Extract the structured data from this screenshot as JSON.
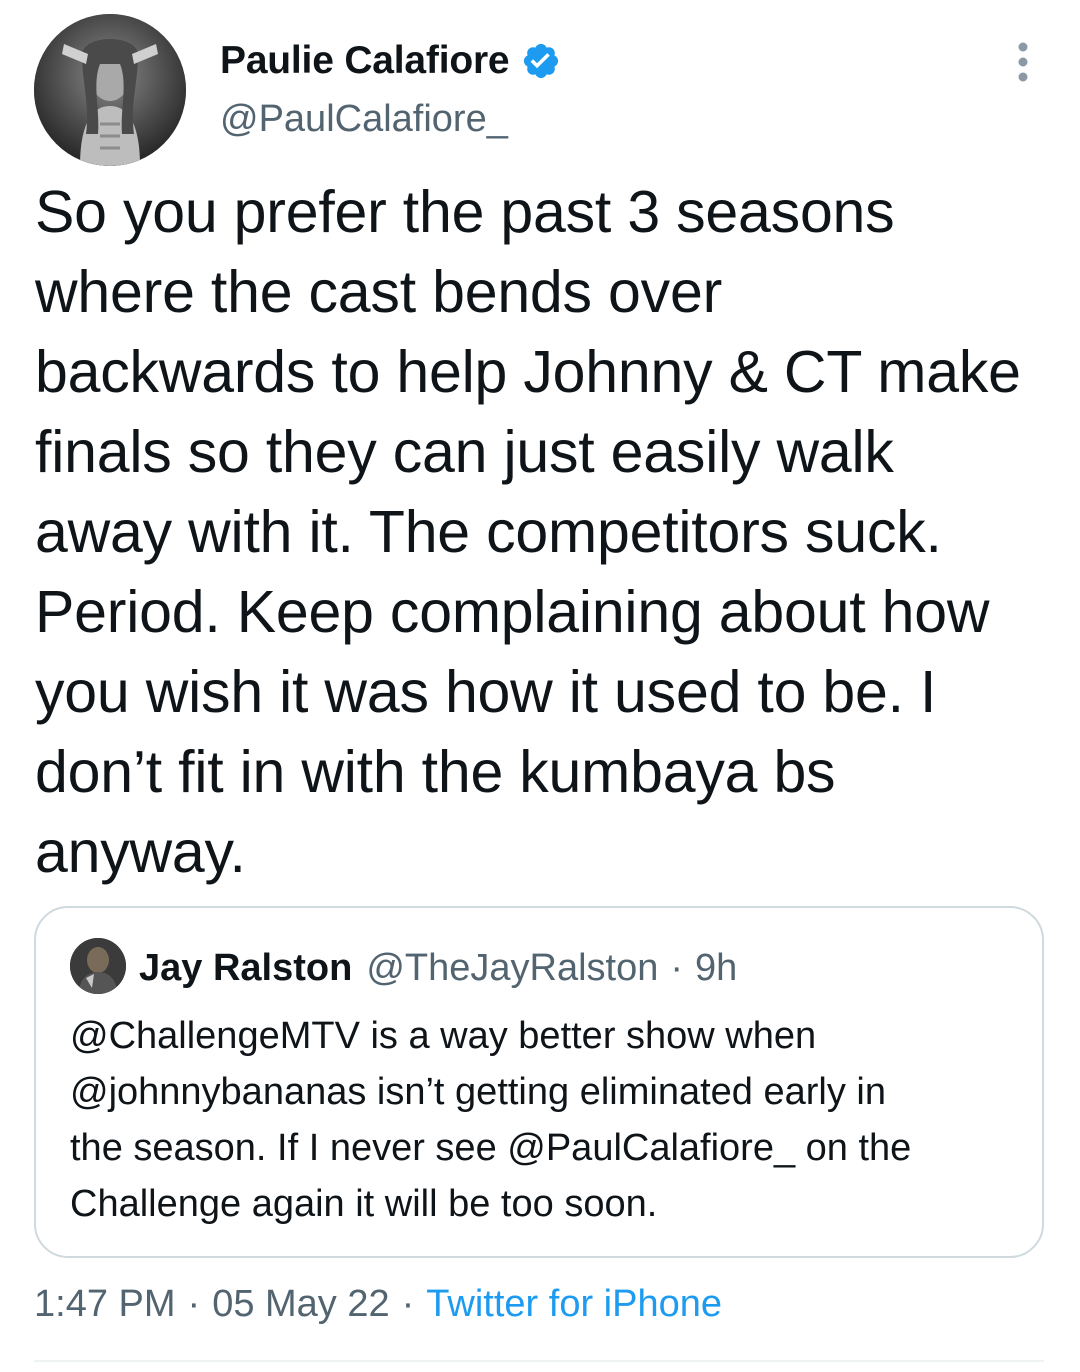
{
  "author": {
    "display_name": "Paulie Calafiore",
    "handle": "@PaulCalafiore_",
    "verified": true,
    "avatar_icon": "profile-photo"
  },
  "tweet": {
    "lines": [
      "So you prefer the past 3 seasons",
      "where the cast bends over",
      "backwards to help Johnny & CT make",
      "finals so they can just easily walk",
      "away with it. The competitors suck.",
      "Period. Keep complaining about how",
      "you wish it was how it used to be. I",
      "don’t fit in with the kumbaya bs",
      "anyway."
    ]
  },
  "quoted_tweet": {
    "display_name": "Jay Ralston",
    "handle": "@TheJayRalston",
    "separator": "·",
    "time": "9h",
    "lines": [
      "@ChallengeMTV is a way better show when",
      "@johnnybananas isn’t getting eliminated early in",
      "the season. If I never see @PaulCalafiore_ on the",
      "Challenge again it will be too soon."
    ]
  },
  "meta": {
    "time": "1:47 PM",
    "separator": "·",
    "date": "05 May 22",
    "source": "Twitter for iPhone"
  },
  "colors": {
    "text": "#0f1419",
    "secondary": "#536471",
    "link": "#1d9bf0",
    "verified": "#1d9bf0",
    "border": "#cfd9de"
  }
}
